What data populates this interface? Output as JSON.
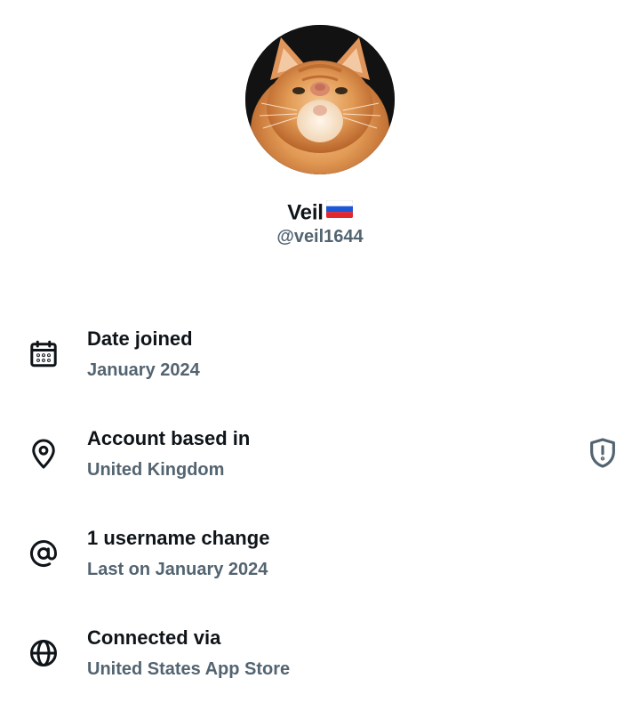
{
  "profile": {
    "display_name": "Veil",
    "flag_emoji": "🇷🇺",
    "handle": "@veil1644"
  },
  "info": [
    {
      "icon": "calendar-icon",
      "title": "Date joined",
      "subtitle": "January 2024"
    },
    {
      "icon": "location-pin-icon",
      "title": "Account based in",
      "subtitle": "United Kingdom",
      "action_icon": "shield-alert-icon"
    },
    {
      "icon": "at-sign-icon",
      "title": "1 username change",
      "subtitle": "Last on January 2024"
    },
    {
      "icon": "globe-icon",
      "title": "Connected via",
      "subtitle": "United States App Store"
    }
  ],
  "colors": {
    "primary_text": "#0f1419",
    "secondary_text": "#536471",
    "background": "#ffffff"
  }
}
